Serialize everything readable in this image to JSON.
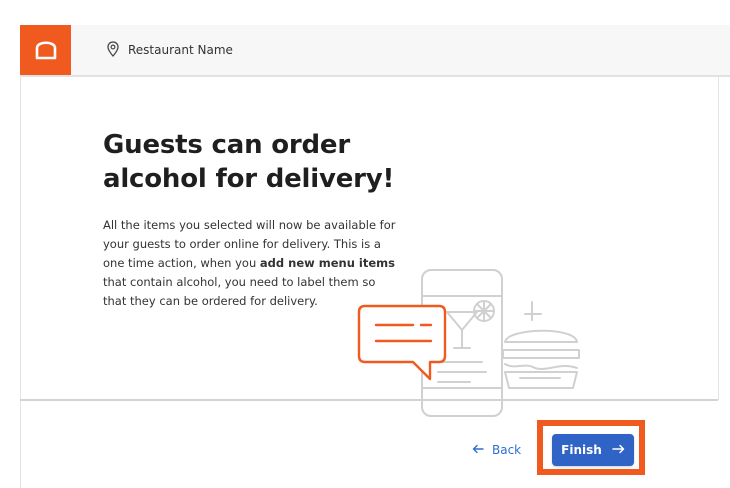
{
  "header": {
    "logo_icon": "toast-logo-icon",
    "location_icon": "location-pin-icon",
    "restaurant_name": "Restaurant Name",
    "brand_color": "#f05a1f"
  },
  "main": {
    "title_line1": "Guests can order",
    "title_line2": "alcohol for delivery!",
    "body_part1": "All the items you selected will now be available for your guests to order online for delivery. This is a one time action, when you ",
    "body_bold": "add new menu items",
    "body_part2": " that contain alcohol, you need to label them so that they can be ordered for delivery.",
    "illustration": "phone-chat-cocktail-burger-illustration"
  },
  "footer": {
    "back_label": "Back",
    "back_icon": "arrow-left-icon",
    "finish_label": "Finish",
    "finish_icon": "arrow-right-icon",
    "accent_color": "#2f63c5",
    "highlight_color": "#f05a1f"
  }
}
